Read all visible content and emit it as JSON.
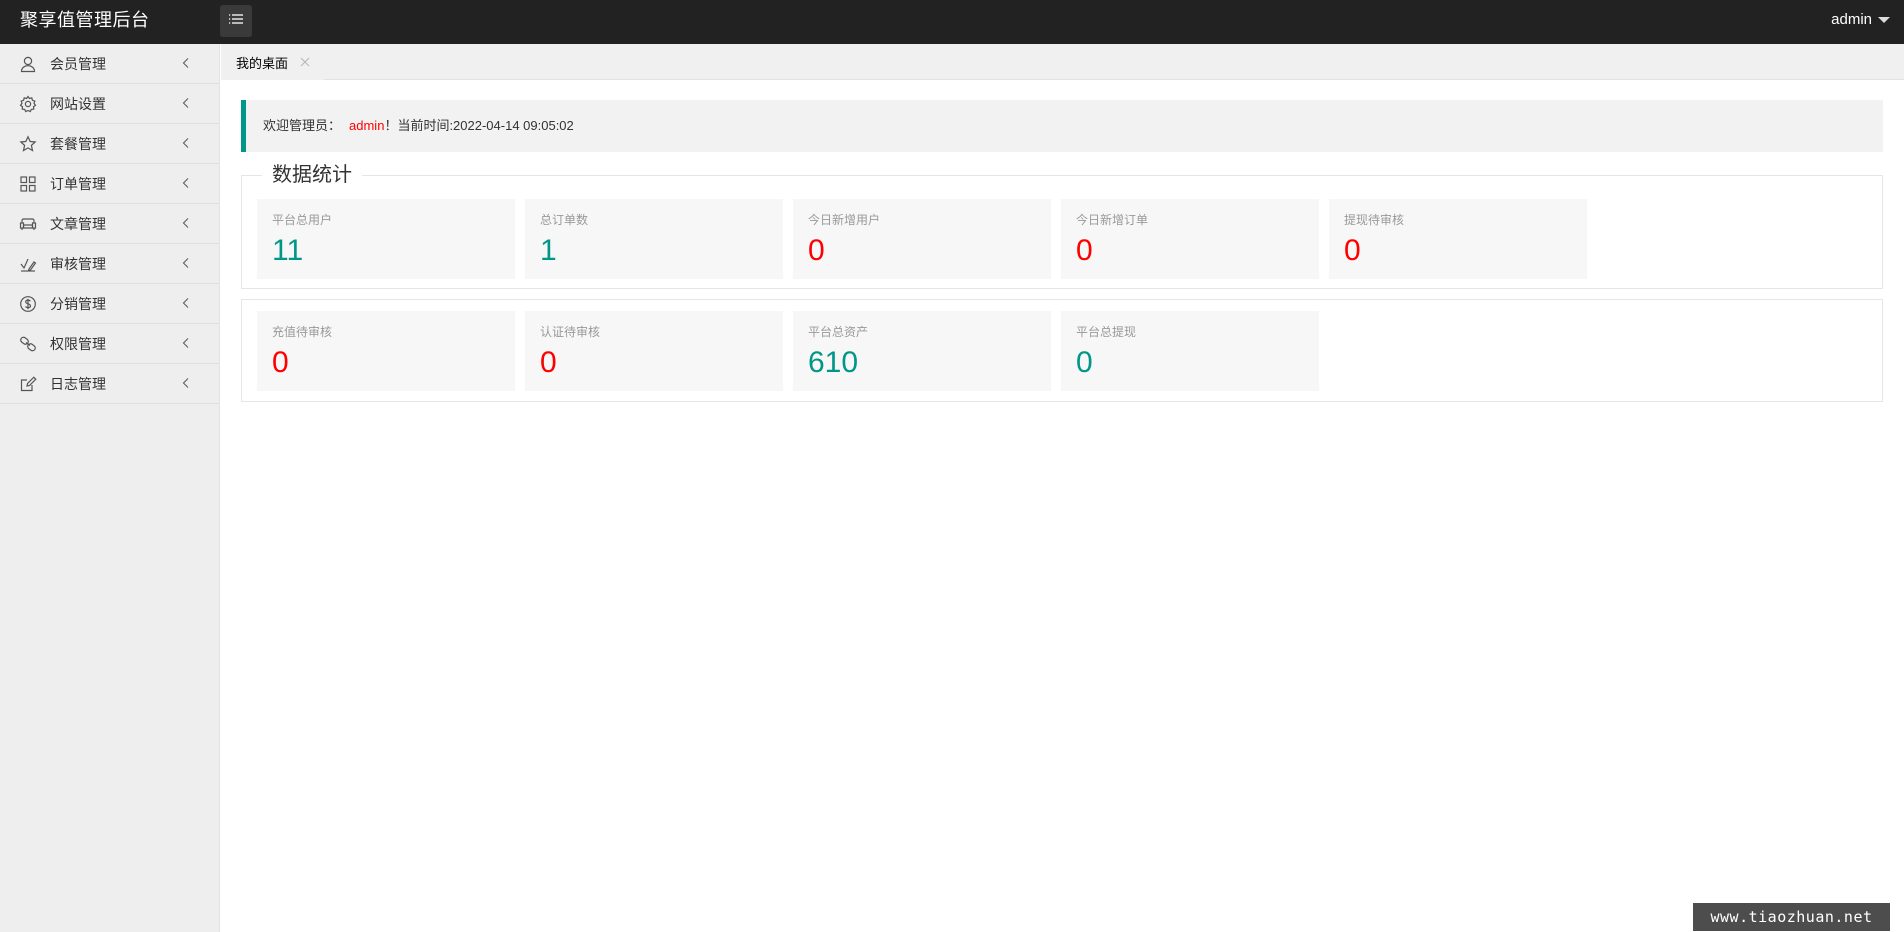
{
  "header": {
    "app_title": "聚享值管理后台",
    "menu_toggle_icon": "list-icon",
    "user_name": "admin"
  },
  "sidebar": {
    "items": [
      {
        "label": "会员管理",
        "icon": "user-icon"
      },
      {
        "label": "网站设置",
        "icon": "gear-icon"
      },
      {
        "label": "套餐管理",
        "icon": "star-icon"
      },
      {
        "label": "订单管理",
        "icon": "grid-icon"
      },
      {
        "label": "文章管理",
        "icon": "sofa-icon"
      },
      {
        "label": "审核管理",
        "icon": "check-pen-icon"
      },
      {
        "label": "分销管理",
        "icon": "dollar-icon"
      },
      {
        "label": "权限管理",
        "icon": "link-icon"
      },
      {
        "label": "日志管理",
        "icon": "edit-icon"
      }
    ]
  },
  "tabs": [
    {
      "label": "我的桌面",
      "closable": true
    }
  ],
  "welcome": {
    "prefix": "欢迎管理员：",
    "user": "admin",
    "suffix": "！当前时间:2022-04-14 09:05:02"
  },
  "stats": {
    "legend": "数据统计",
    "row1": [
      {
        "label": "平台总用户",
        "value": "11",
        "color": "#009688"
      },
      {
        "label": "总订单数",
        "value": "1",
        "color": "#009688"
      },
      {
        "label": "今日新增用户",
        "value": "0",
        "color": "#ff0000"
      },
      {
        "label": "今日新增订单",
        "value": "0",
        "color": "#ff0000"
      },
      {
        "label": "提现待审核",
        "value": "0",
        "color": "#ff0000"
      }
    ],
    "row2": [
      {
        "label": "充值待审核",
        "value": "0",
        "color": "#ff0000"
      },
      {
        "label": "认证待审核",
        "value": "0",
        "color": "#ff0000"
      },
      {
        "label": "平台总资产",
        "value": "610",
        "color": "#009688"
      },
      {
        "label": "平台总提现",
        "value": "0",
        "color": "#009688"
      }
    ]
  },
  "colors": {
    "accent": "#009688",
    "alert": "#ff0000",
    "topbar": "#222222"
  },
  "watermark": "www.tiaozhuan.net"
}
